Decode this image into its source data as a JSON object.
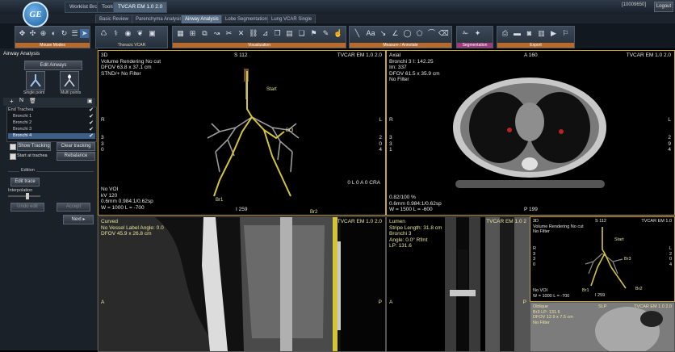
{
  "topbar": {
    "logo_text": "GE",
    "tabs": [
      "Worklist Browser",
      "Tools",
      "TVCAR EM 1.0 2.0"
    ],
    "user_id": "[10009650]",
    "logout_label": "Logout"
  },
  "subtabs": [
    "Basic Review",
    "Parenchyma Analysis",
    "Airway Analysis",
    "Lobe Segmentation",
    "Lung VCAR Single"
  ],
  "toolbar_groups": [
    {
      "label": "Mouse Modes",
      "color": "orange"
    },
    {
      "label": "Thoracic VCAR",
      "color": "plain"
    },
    {
      "label": "Visualization",
      "color": "orange"
    },
    {
      "label": "Measure / Annotate",
      "color": "orange"
    },
    {
      "label": "Segmentation",
      "color": "pink"
    },
    {
      "label": "Export",
      "color": "orange"
    }
  ],
  "left_panel": {
    "title": "Airway Analysis",
    "edit_airways": "Edit Airways",
    "single_point": "Single point",
    "multi_points": "Multi points",
    "tree_items": [
      "End Trachea",
      "Bronchi 1",
      "Bronchi 2",
      "Bronchi 3",
      "Bronchi 4"
    ],
    "show_tracking": "Show Tracking",
    "clear_tracking": "Clear tracking",
    "start_at_trachea": "Start at trachea",
    "rebalance": "Rebalance",
    "edition_label": "Edition",
    "edit_trace": "Edit trace",
    "interpolation": "Interpolation",
    "undo_edit": "Undo edit",
    "accept": "Accept",
    "next": "Next"
  },
  "vp_3d": {
    "tl": [
      "3D",
      "Volume Rendering No cut",
      "DFOV 63.8 x 37.1 cm",
      "STND/+ No Filter"
    ],
    "top_center": "S 112",
    "tr": "TVCAR EM 1.0 2.0",
    "left_R": "R",
    "right_L": "L",
    "left_nums": [
      "3",
      "3",
      "0"
    ],
    "right_nums": [
      "2",
      "0",
      "4"
    ],
    "bl": [
      "No VOI",
      "kV 120",
      "0.6mm 0.984:1/0.62sp",
      "W = 1000 L = -700"
    ],
    "bottom_center": "I 259",
    "br": "0 L 0 A 0 CRA",
    "labels": [
      "Start",
      "Br3",
      "Br1",
      "Br2"
    ]
  },
  "vp_axial": {
    "tl": [
      "Axial",
      "Bronchi 3 I: 142.25",
      "Im: 337",
      "DFOV 61.5 x 35.9 cm",
      "No Filter"
    ],
    "top_center": "A 160",
    "tr": "TVCAR EM 1.0 2.0",
    "left_R": "R",
    "right_L": "L",
    "left_nums": [
      "3",
      "3",
      "1"
    ],
    "right_nums": [
      "2",
      "9",
      "4"
    ],
    "bl": [
      "0.82/100 %",
      "0.6mm 0.984:1/0.62sp",
      "W = 1500 L = -600"
    ],
    "bottom_center": "P 199"
  },
  "vp_curved": {
    "tl": [
      "Curved",
      "No Vessel Label Angle: 0.0",
      "DFOV 45.9 x 26.8 cm"
    ],
    "tr": "TVCAR EM 1.0 2.0",
    "left_A": "A",
    "right_P": "P"
  },
  "vp_lumen": {
    "tl": [
      "Lumen",
      "Stripe Length: 31.8 cm",
      "Bronchi 3",
      "Angle: 0.0° Rfmt",
      "LP: 131.6"
    ],
    "tr": "TVCAR EM 1.0 2",
    "left_A": "A",
    "right_P": "P"
  },
  "vp_small3d": {
    "tl": [
      "3D",
      "Volume Rendering No cut",
      "No Filter"
    ],
    "top_center": "S 112",
    "tr": "TVCAR EM 1.0",
    "left_nums": [
      "R",
      "3",
      "3",
      "0"
    ],
    "right_nums": [
      "L",
      "2",
      "0",
      "4"
    ],
    "bl": [
      "No VOI",
      "W = 1000 L = -700"
    ],
    "bottom_center": "I 259",
    "labels": [
      "Start",
      "Br3",
      "Br1",
      "Br2"
    ]
  },
  "vp_oblique": {
    "tl": [
      "Oblique",
      "Br3 LP: 131.6",
      "DFOV 12.9 x 7.5 cm",
      "No Filter"
    ],
    "tr": "TVCAR EM 1.0 2.0",
    "top_right": "SLP"
  },
  "colors": {
    "vp_border": "#c8a830",
    "overlay_text": "#e9e4a0",
    "airway_path": "#d4c43a",
    "toolbar_orange": "#b9692a",
    "toolbar_pink": "#a03a78"
  }
}
